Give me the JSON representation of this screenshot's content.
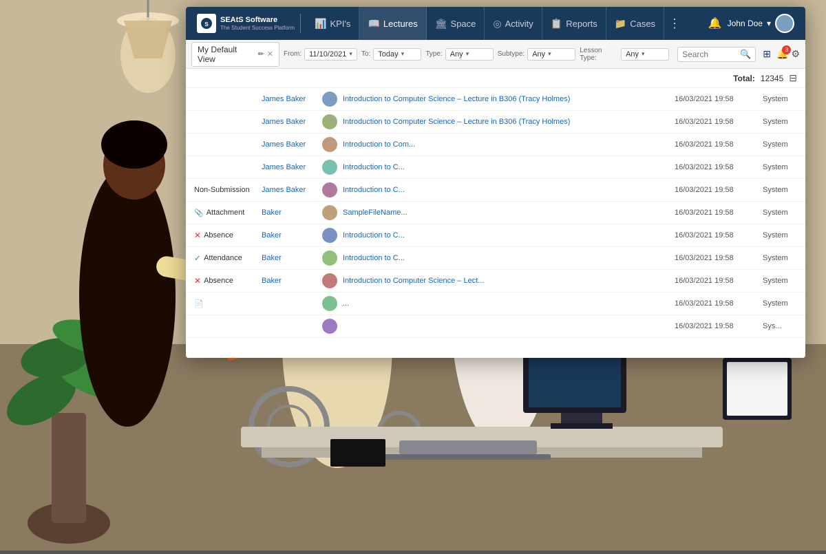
{
  "app": {
    "title": "SEAtS Software",
    "subtitle": "The Student Success Platform",
    "logo_bg": "#1a3a5c"
  },
  "nav": {
    "items": [
      {
        "id": "kpis",
        "label": "KPI's",
        "icon": "📊",
        "active": false
      },
      {
        "id": "lectures",
        "label": "Lectures",
        "icon": "📖",
        "active": true
      },
      {
        "id": "space",
        "label": "Space",
        "icon": "🏛",
        "active": false
      },
      {
        "id": "activity",
        "label": "Activity",
        "icon": "◎",
        "active": false
      },
      {
        "id": "reports",
        "label": "Reports",
        "icon": "📋",
        "active": false
      },
      {
        "id": "cases",
        "label": "Cases",
        "icon": "📁",
        "active": false
      }
    ],
    "more_icon": "⋮",
    "bell_icon": "🔔",
    "user_name": "John Doe",
    "user_chevron": "▾"
  },
  "toolbar": {
    "view_tab_label": "My Default View",
    "edit_icon": "✏",
    "close_icon": "✕",
    "filters": {
      "from": {
        "label": "From:",
        "value": "11/10/2021",
        "chevron": "▾"
      },
      "to": {
        "label": "To:",
        "value": "Today",
        "chevron": "▾"
      },
      "type": {
        "label": "Type:",
        "value": "Any",
        "chevron": "▾"
      },
      "subtype": {
        "label": "Subtype:",
        "value": "Any",
        "chevron": "▾"
      },
      "lesson_type": {
        "label": "Lesson Type:",
        "value": "Any",
        "chevron": "▾"
      }
    },
    "search_placeholder": "Search",
    "search_icon": "🔍",
    "view_grid_icon": "⊞",
    "notification_count": "3",
    "settings_icon": "⚙"
  },
  "total": {
    "label": "Total:",
    "count": "12345",
    "columns_icon": "⊟"
  },
  "table": {
    "rows": [
      {
        "type": "",
        "type_icon": "",
        "student": "James Baker",
        "subject": "Introduction to Computer Science – Lecture in B306 (Tracy Holmes)",
        "date": "16/03/2021 19:58",
        "source": "System"
      },
      {
        "type": "",
        "type_icon": "",
        "student": "James Baker",
        "subject": "Introduction to Computer Science – Lecture in B306 (Tracy Holmes)",
        "date": "16/03/2021 19:58",
        "source": "System"
      },
      {
        "type": "",
        "type_icon": "",
        "student": "James Baker",
        "subject": "Introduction to Com...",
        "date": "16/03/2021 19:58",
        "source": "System"
      },
      {
        "type": "",
        "type_icon": "",
        "student": "James Baker",
        "subject": "Introduction to C...",
        "date": "16/03/2021 19:58",
        "source": "System"
      },
      {
        "type": "Non-Submission",
        "type_icon": "",
        "student": "James Baker",
        "subject": "Introduction to C...",
        "date": "16/03/2021 19:58",
        "source": "System"
      },
      {
        "type": "Attachment",
        "type_icon": "📎",
        "student": "Baker",
        "subject": "SampleFileName...",
        "date": "16/03/2021 19:58",
        "source": "System"
      },
      {
        "type": "Absence",
        "type_icon": "absence",
        "student": "Baker",
        "subject": "Introduction to C...",
        "date": "16/03/2021 19:58",
        "source": "System"
      },
      {
        "type": "Attendance",
        "type_icon": "attendance",
        "student": "Baker",
        "subject": "Introduction to C...",
        "date": "16/03/2021 19:58",
        "source": "System"
      },
      {
        "type": "Absence",
        "type_icon": "absence",
        "student": "Baker",
        "subject": "Introduction to Computer Science – Lect...",
        "date": "16/03/2021 19:58",
        "source": "System"
      },
      {
        "type": "",
        "type_icon": "📄",
        "student": "",
        "subject": "...",
        "date": "16/03/2021 19:58",
        "source": "System"
      },
      {
        "type": "",
        "type_icon": "",
        "student": "",
        "subject": "",
        "date": "16/03/2021 19:58",
        "source": "Sys..."
      }
    ],
    "avatar_colors": [
      "#7a9ec0",
      "#9eb07a",
      "#c09a7a",
      "#7ac0b0",
      "#b07a9e",
      "#c0a07a",
      "#7a90c0",
      "#90c07a",
      "#c07a7a",
      "#7ac090",
      "#a07ac0"
    ]
  }
}
